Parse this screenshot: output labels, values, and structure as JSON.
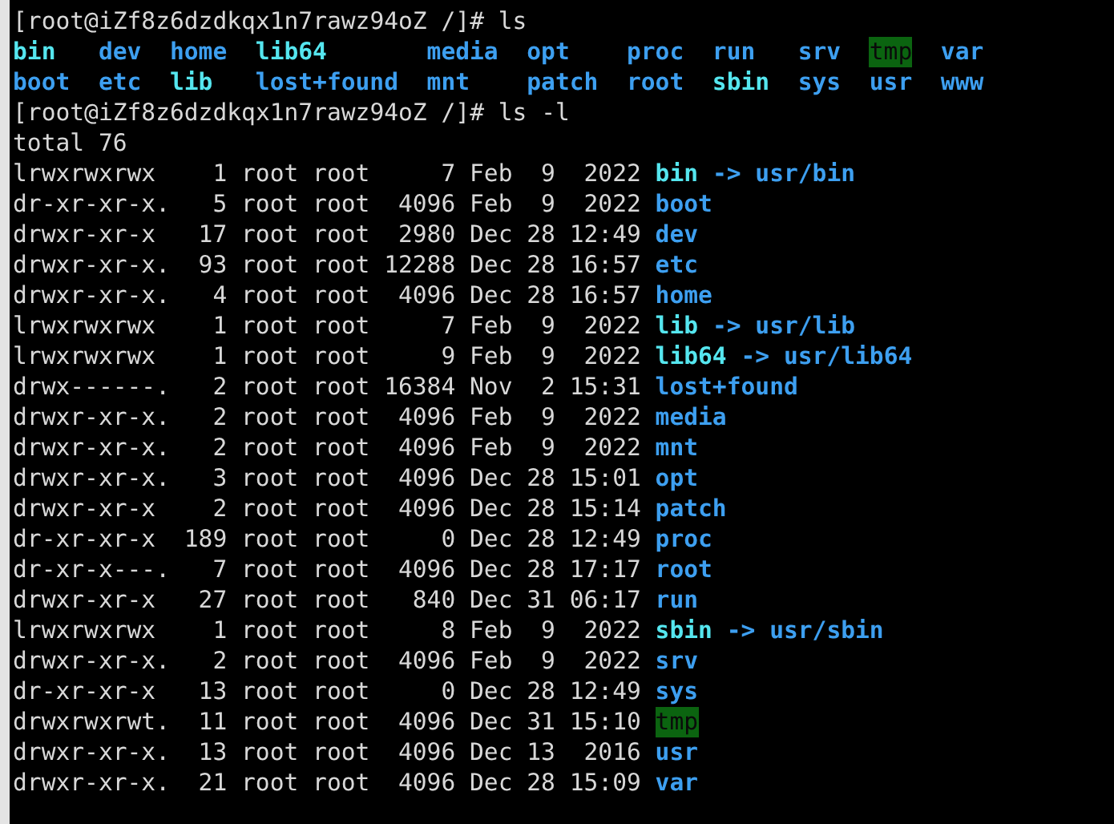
{
  "prompt_1": {
    "prompt": "[root@iZf8z6dzdkqx1n7rawz94oZ /]#",
    "command": "ls"
  },
  "ls_grid": [
    [
      {
        "name": "bin",
        "kind": "link"
      },
      {
        "name": "boot",
        "kind": "dir"
      }
    ],
    [
      {
        "name": "dev",
        "kind": "dir"
      },
      {
        "name": "etc",
        "kind": "dir"
      }
    ],
    [
      {
        "name": "home",
        "kind": "dir"
      },
      {
        "name": "lib",
        "kind": "link"
      }
    ],
    [
      {
        "name": "lib64",
        "kind": "link"
      },
      {
        "name": "lost+found",
        "kind": "dir"
      }
    ],
    [
      {
        "name": "media",
        "kind": "dir"
      },
      {
        "name": "mnt",
        "kind": "dir"
      }
    ],
    [
      {
        "name": "opt",
        "kind": "dir"
      },
      {
        "name": "patch",
        "kind": "dir"
      }
    ],
    [
      {
        "name": "proc",
        "kind": "dir"
      },
      {
        "name": "root",
        "kind": "dir"
      }
    ],
    [
      {
        "name": "run",
        "kind": "dir"
      },
      {
        "name": "sbin",
        "kind": "link"
      }
    ],
    [
      {
        "name": "srv",
        "kind": "dir"
      },
      {
        "name": "sys",
        "kind": "dir"
      }
    ],
    [
      {
        "name": "tmp",
        "kind": "sticky"
      },
      {
        "name": "usr",
        "kind": "dir"
      }
    ],
    [
      {
        "name": "var",
        "kind": "dir"
      },
      {
        "name": "www",
        "kind": "dir"
      }
    ]
  ],
  "prompt_2": {
    "prompt": "[root@iZf8z6dzdkqx1n7rawz94oZ /]#",
    "command": "ls -l"
  },
  "total": "total 76",
  "listing": [
    {
      "perms": "lrwxrwxrwx",
      "links": "1",
      "owner": "root",
      "group": "root",
      "size": "7",
      "month": "Feb",
      "day": "9",
      "time": "2022",
      "name": "bin",
      "kind": "link",
      "arrow": "->",
      "target": "usr/bin"
    },
    {
      "perms": "dr-xr-xr-x.",
      "links": "5",
      "owner": "root",
      "group": "root",
      "size": "4096",
      "month": "Feb",
      "day": "9",
      "time": "2022",
      "name": "boot",
      "kind": "dir"
    },
    {
      "perms": "drwxr-xr-x",
      "links": "17",
      "owner": "root",
      "group": "root",
      "size": "2980",
      "month": "Dec",
      "day": "28",
      "time": "12:49",
      "name": "dev",
      "kind": "dir"
    },
    {
      "perms": "drwxr-xr-x.",
      "links": "93",
      "owner": "root",
      "group": "root",
      "size": "12288",
      "month": "Dec",
      "day": "28",
      "time": "16:57",
      "name": "etc",
      "kind": "dir"
    },
    {
      "perms": "drwxr-xr-x.",
      "links": "4",
      "owner": "root",
      "group": "root",
      "size": "4096",
      "month": "Dec",
      "day": "28",
      "time": "16:57",
      "name": "home",
      "kind": "dir"
    },
    {
      "perms": "lrwxrwxrwx",
      "links": "1",
      "owner": "root",
      "group": "root",
      "size": "7",
      "month": "Feb",
      "day": "9",
      "time": "2022",
      "name": "lib",
      "kind": "link",
      "arrow": "->",
      "target": "usr/lib"
    },
    {
      "perms": "lrwxrwxrwx",
      "links": "1",
      "owner": "root",
      "group": "root",
      "size": "9",
      "month": "Feb",
      "day": "9",
      "time": "2022",
      "name": "lib64",
      "kind": "link",
      "arrow": "->",
      "target": "usr/lib64"
    },
    {
      "perms": "drwx------.",
      "links": "2",
      "owner": "root",
      "group": "root",
      "size": "16384",
      "month": "Nov",
      "day": "2",
      "time": "15:31",
      "name": "lost+found",
      "kind": "dir"
    },
    {
      "perms": "drwxr-xr-x.",
      "links": "2",
      "owner": "root",
      "group": "root",
      "size": "4096",
      "month": "Feb",
      "day": "9",
      "time": "2022",
      "name": "media",
      "kind": "dir"
    },
    {
      "perms": "drwxr-xr-x.",
      "links": "2",
      "owner": "root",
      "group": "root",
      "size": "4096",
      "month": "Feb",
      "day": "9",
      "time": "2022",
      "name": "mnt",
      "kind": "dir"
    },
    {
      "perms": "drwxr-xr-x.",
      "links": "3",
      "owner": "root",
      "group": "root",
      "size": "4096",
      "month": "Dec",
      "day": "28",
      "time": "15:01",
      "name": "opt",
      "kind": "dir"
    },
    {
      "perms": "drwxr-xr-x",
      "links": "2",
      "owner": "root",
      "group": "root",
      "size": "4096",
      "month": "Dec",
      "day": "28",
      "time": "15:14",
      "name": "patch",
      "kind": "dir"
    },
    {
      "perms": "dr-xr-xr-x",
      "links": "189",
      "owner": "root",
      "group": "root",
      "size": "0",
      "month": "Dec",
      "day": "28",
      "time": "12:49",
      "name": "proc",
      "kind": "dir"
    },
    {
      "perms": "dr-xr-x---.",
      "links": "7",
      "owner": "root",
      "group": "root",
      "size": "4096",
      "month": "Dec",
      "day": "28",
      "time": "17:17",
      "name": "root",
      "kind": "dir"
    },
    {
      "perms": "drwxr-xr-x",
      "links": "27",
      "owner": "root",
      "group": "root",
      "size": "840",
      "month": "Dec",
      "day": "31",
      "time": "06:17",
      "name": "run",
      "kind": "dir"
    },
    {
      "perms": "lrwxrwxrwx",
      "links": "1",
      "owner": "root",
      "group": "root",
      "size": "8",
      "month": "Feb",
      "day": "9",
      "time": "2022",
      "name": "sbin",
      "kind": "link",
      "arrow": "->",
      "target": "usr/sbin"
    },
    {
      "perms": "drwxr-xr-x.",
      "links": "2",
      "owner": "root",
      "group": "root",
      "size": "4096",
      "month": "Feb",
      "day": "9",
      "time": "2022",
      "name": "srv",
      "kind": "dir"
    },
    {
      "perms": "dr-xr-xr-x",
      "links": "13",
      "owner": "root",
      "group": "root",
      "size": "0",
      "month": "Dec",
      "day": "28",
      "time": "12:49",
      "name": "sys",
      "kind": "dir"
    },
    {
      "perms": "drwxrwxrwt.",
      "links": "11",
      "owner": "root",
      "group": "root",
      "size": "4096",
      "month": "Dec",
      "day": "31",
      "time": "15:10",
      "name": "tmp",
      "kind": "sticky"
    },
    {
      "perms": "drwxr-xr-x.",
      "links": "13",
      "owner": "root",
      "group": "root",
      "size": "4096",
      "month": "Dec",
      "day": "13",
      "time": "2016",
      "name": "usr",
      "kind": "dir"
    },
    {
      "perms": "drwxr-xr-x.",
      "links": "21",
      "owner": "root",
      "group": "root",
      "size": "4096",
      "month": "Dec",
      "day": "28",
      "time": "15:09",
      "name": "var",
      "kind": "dir"
    }
  ]
}
